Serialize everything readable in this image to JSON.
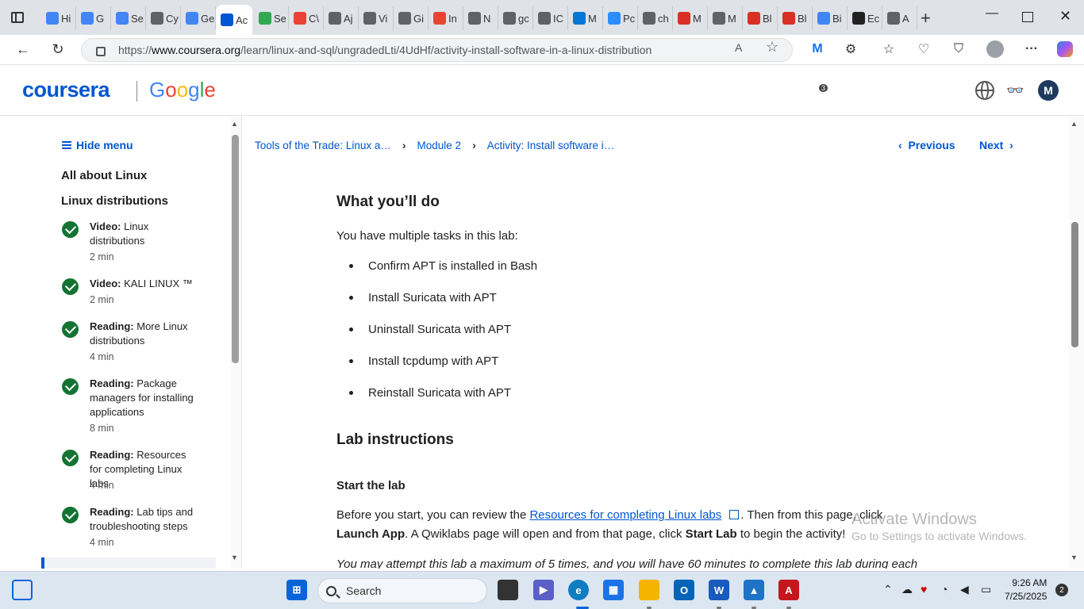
{
  "browser": {
    "tabs": [
      {
        "label": "Hi",
        "color": "#4285f4"
      },
      {
        "label": "G",
        "color": "#4285f4"
      },
      {
        "label": "Se",
        "color": "#4285f4"
      },
      {
        "label": "Cy",
        "color": "#5f6368"
      },
      {
        "label": "Ge",
        "color": "#4285f4"
      },
      {
        "label": "Ac",
        "color": "#0056d2"
      },
      {
        "label": "Se",
        "color": "#34a853"
      },
      {
        "label": "C\\",
        "color": "#ea4335"
      },
      {
        "label": "Aj",
        "color": "#5f6368"
      },
      {
        "label": "Vi",
        "color": "#5f6368"
      },
      {
        "label": "Gi",
        "color": "#5f6368"
      },
      {
        "label": "In",
        "color": "#ea4335"
      },
      {
        "label": "N",
        "color": "#5f6368"
      },
      {
        "label": "gc",
        "color": "#5f6368"
      },
      {
        "label": "IC",
        "color": "#5f6368"
      },
      {
        "label": "M",
        "color": "#0078d4"
      },
      {
        "label": "Pc",
        "color": "#2d8cff"
      },
      {
        "label": "ch",
        "color": "#5f6368"
      },
      {
        "label": "M",
        "color": "#d93025"
      },
      {
        "label": "M",
        "color": "#5f6368"
      },
      {
        "label": "Bl",
        "color": "#d93025"
      },
      {
        "label": "Bl",
        "color": "#d93025"
      },
      {
        "label": "Bi",
        "color": "#4285f4"
      },
      {
        "label": "Ec",
        "color": "#222"
      },
      {
        "label": "A",
        "color": "#5f6368"
      }
    ],
    "active_tab_index": 5,
    "url_prefix": "https://",
    "url_domain": "www.coursera.org",
    "url_path": "/learn/linux-and-sql/ungradedLti/4UdHf/activity-install-software-in-a-linux-distribution",
    "extension_badge": "3"
  },
  "site": {
    "logo": "coursera",
    "partner": "Google",
    "avatar_letter": "M"
  },
  "sidebar": {
    "hide_menu": "Hide menu",
    "section1": "All about Linux",
    "section2": "Linux distributions",
    "items": [
      {
        "type": "Video:",
        "title": " Linux distributions",
        "duration": "2 min"
      },
      {
        "type": "Video:",
        "title": " KALI LINUX ™",
        "duration": "2 min"
      },
      {
        "type": "Reading:",
        "title": " More Linux distributions",
        "duration": "4 min"
      },
      {
        "type": "Reading:",
        "title": " Package managers for installing applications",
        "duration": "8 min"
      },
      {
        "type": "Reading:",
        "title": " Resources for completing Linux labs",
        "duration": "4 min"
      },
      {
        "type": "Reading:",
        "title": " Lab tips and troubleshooting steps",
        "duration": "4 min"
      }
    ]
  },
  "breadcrumb": {
    "course": "Tools of the Trade: Linux a…",
    "module": "Module 2",
    "activity": "Activity: Install software i…"
  },
  "pager": {
    "previous": "Previous",
    "next": "Next"
  },
  "content": {
    "heading1": "What you’ll do",
    "intro": "You have multiple tasks in this lab:",
    "tasks": [
      "Confirm APT is installed in Bash",
      "Install Suricata with APT",
      "Uninstall Suricata with APT",
      "Install tcpdump with APT",
      "Reinstall Suricata with APT"
    ],
    "heading2": "Lab instructions",
    "heading3": "Start the lab",
    "para_before": "Before you start, you can review the ",
    "para_link": "Resources for completing Linux labs",
    "para_mid1": ". Then from this page, click ",
    "para_bold1": "Launch App",
    "para_mid2": ". A Qwiklabs page will open and from that page, click ",
    "para_bold2": "Start Lab",
    "para_end": " to begin the activity!",
    "italic": "You may attempt this lab a maximum of 5 times, and you will have 60 minutes to complete this lab during each"
  },
  "watermark": {
    "line1": "Activate Windows",
    "line2": "Go to Settings to activate Windows."
  },
  "taskbar": {
    "search": "Search",
    "time": "9:26 AM",
    "date": "7/25/2025",
    "notifications": "2"
  }
}
